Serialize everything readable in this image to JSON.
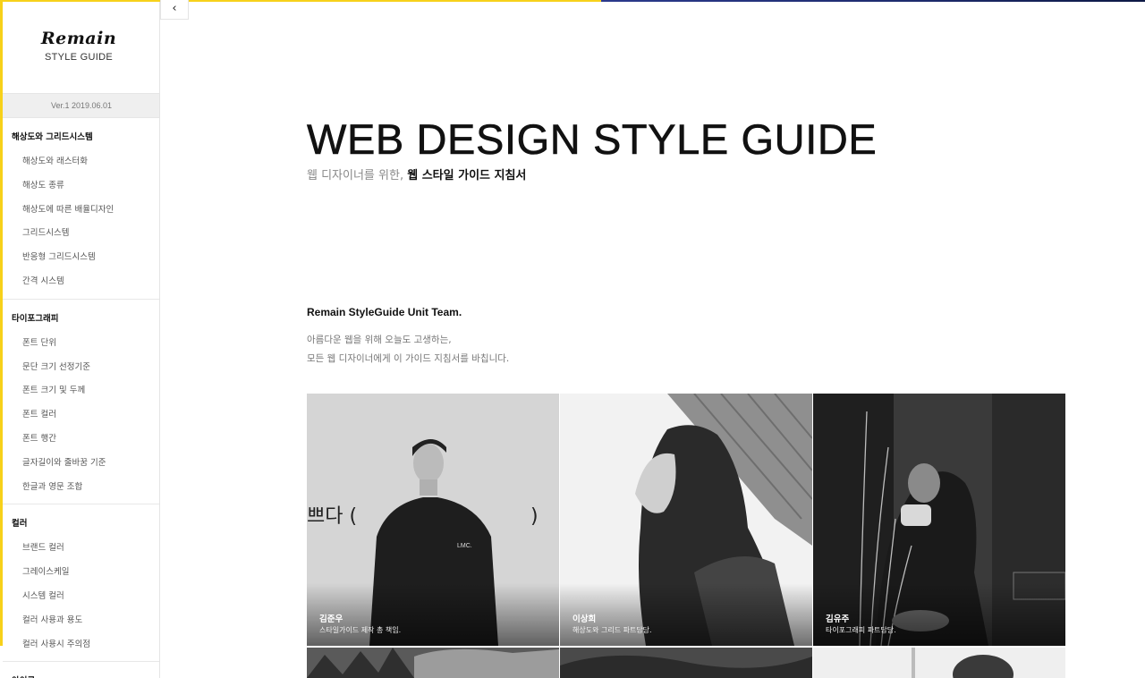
{
  "sidebar": {
    "collapse_icon": "‹",
    "logo": "Remain",
    "logo_sub": "STYLE GUIDE",
    "version": "Ver.1 2019.06.01",
    "groups": [
      {
        "heading": "해상도와 그리드시스템",
        "items": [
          "해상도와 래스터화",
          "해상도 종류",
          "해상도에 따른 배율디자인",
          "그리드시스템",
          "반응형 그리드시스템",
          "간격 시스템"
        ]
      },
      {
        "heading": "타이포그래피",
        "items": [
          "폰트 단위",
          "문단 크기 선정기준",
          "폰트 크기 및 두께",
          "폰트 컬러",
          "폰트 행간",
          "글자길이와 줄바꿈 기준",
          "한글과 영문 조합"
        ]
      },
      {
        "heading": "컬러",
        "items": [
          "브랜드 컬러",
          "그레이스케일",
          "시스템 컬러",
          "컬러 사용과 용도",
          "컬러 사용시 주의점"
        ]
      },
      {
        "heading": "아이콘",
        "items": []
      }
    ]
  },
  "main": {
    "title": "WEB DESIGN STYLE GUIDE",
    "subtitle_light": "웹 디자이너를 위한,",
    "subtitle_bold": "웹 스타일 가이드 지침서",
    "team_title": "Remain StyleGuide Unit Team.",
    "team_desc_line1": "아름다운 웹을 위해 오늘도 고생하는,",
    "team_desc_line2": "모든 웹 디자이너에게 이 가이드 지침서를 바칩니다."
  },
  "team": [
    {
      "name": "김준우",
      "role": "스타일가이드 제작 총 책임."
    },
    {
      "name": "이상희",
      "role": "해상도와 그리드 파트담당."
    },
    {
      "name": "김유주",
      "role": "타이포그래피 파트담당."
    }
  ],
  "photo_text": {
    "wall_text": "쁘다 (",
    "wall_paren": ")",
    "shirt_text": "LMC."
  },
  "colors": {
    "accent_yellow": "#f7d11a",
    "accent_navy": "#1c2a6b"
  }
}
